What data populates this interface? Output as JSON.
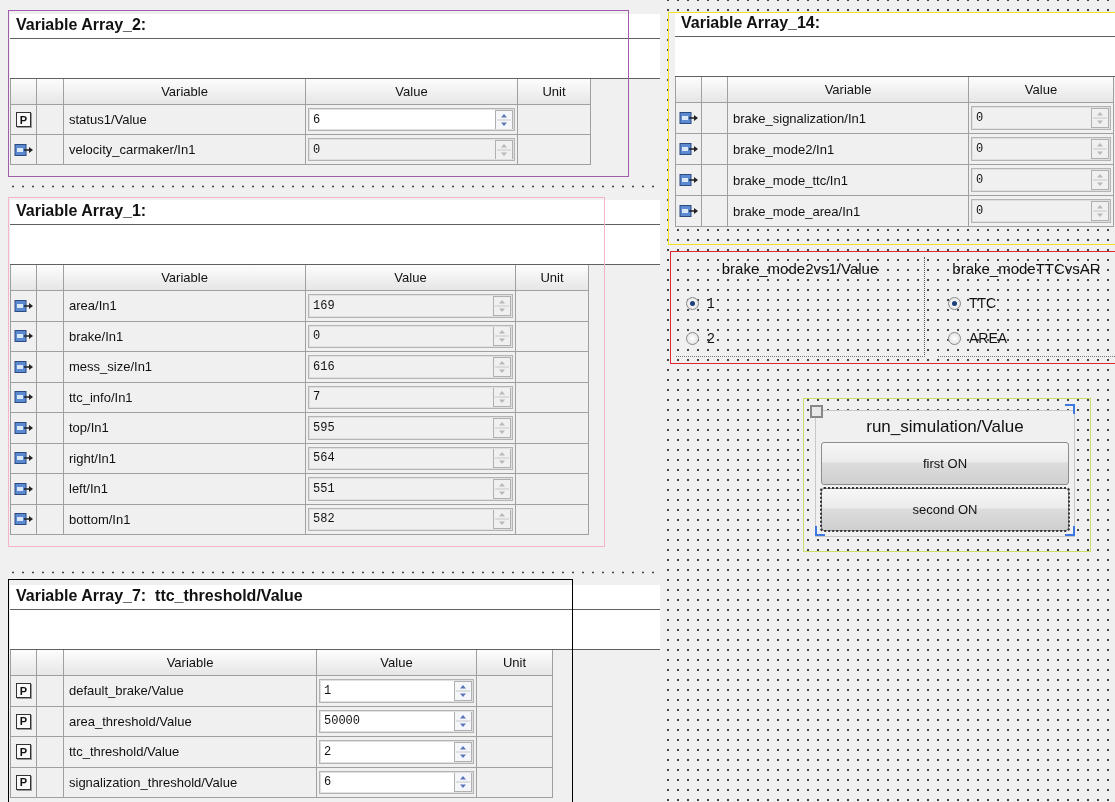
{
  "panels": [
    {
      "kind": "variable_array",
      "title": "Variable Array_2:",
      "color": "#a15cae",
      "columns": [
        "Variable",
        "Value",
        "Unit"
      ],
      "rows": [
        {
          "kind": "parameter",
          "badge": "P",
          "variable": "status1/Value",
          "value": "6"
        },
        {
          "kind": "measurement",
          "variable": "velocity_carmaker/In1",
          "value": "0"
        }
      ]
    },
    {
      "kind": "variable_array",
      "title": "Variable Array_14:",
      "color": "#f2e41c",
      "columns": [
        "Variable",
        "Value"
      ],
      "rows": [
        {
          "kind": "measurement",
          "variable": "brake_signalization/In1",
          "value": "0"
        },
        {
          "kind": "measurement",
          "variable": "brake_mode2/In1",
          "value": "0"
        },
        {
          "kind": "measurement",
          "variable": "brake_mode_ttc/In1",
          "value": "0"
        },
        {
          "kind": "measurement",
          "variable": "brake_mode_area/In1",
          "value": "0"
        }
      ]
    },
    {
      "kind": "variable_array",
      "title": "Variable Array_1:",
      "color": "#f5b3cb",
      "columns": [
        "Variable",
        "Value",
        "Unit"
      ],
      "rows": [
        {
          "kind": "measurement",
          "variable": "area/In1",
          "value": "169"
        },
        {
          "kind": "measurement",
          "variable": "brake/In1",
          "value": "0"
        },
        {
          "kind": "measurement",
          "variable": "mess_size/In1",
          "value": "616"
        },
        {
          "kind": "measurement",
          "variable": "ttc_info/In1",
          "value": "7"
        },
        {
          "kind": "measurement",
          "variable": "top/In1",
          "value": "595"
        },
        {
          "kind": "measurement",
          "variable": "right/In1",
          "value": "564"
        },
        {
          "kind": "measurement",
          "variable": "left/In1",
          "value": "551"
        },
        {
          "kind": "measurement",
          "variable": "bottom/In1",
          "value": "582"
        }
      ]
    },
    {
      "kind": "radio_groups",
      "color": "#e3262e",
      "groups": [
        {
          "title": "brake_mode2vs1/Value",
          "options": [
            {
              "label": "1",
              "selected": true
            },
            {
              "label": "2",
              "selected": false
            }
          ]
        },
        {
          "title": "brake_modeTTCvsAR",
          "options": [
            {
              "label": "TTC",
              "selected": true
            },
            {
              "label": "AREA",
              "selected": false
            }
          ]
        }
      ]
    },
    {
      "kind": "push_buttons",
      "color": "#c8e26a",
      "title": "run_simulation/Value",
      "buttons": [
        {
          "label": "first ON",
          "focused": false
        },
        {
          "label": "second ON",
          "focused": true
        }
      ]
    },
    {
      "kind": "variable_array",
      "title": "Variable Array_7:  ttc_threshold/Value",
      "color": "#000000",
      "columns": [
        "Variable",
        "Value",
        "Unit"
      ],
      "rows": [
        {
          "kind": "parameter",
          "badge": "P",
          "variable": "default_brake/Value",
          "value": "1"
        },
        {
          "kind": "parameter",
          "badge": "P",
          "variable": "area_threshold/Value",
          "value": "50000"
        },
        {
          "kind": "parameter",
          "badge": "P",
          "variable": "ttc_threshold/Value",
          "value": "2"
        },
        {
          "kind": "parameter",
          "badge": "P",
          "variable": "signalization_threshold/Value",
          "value": "6"
        }
      ]
    }
  ]
}
